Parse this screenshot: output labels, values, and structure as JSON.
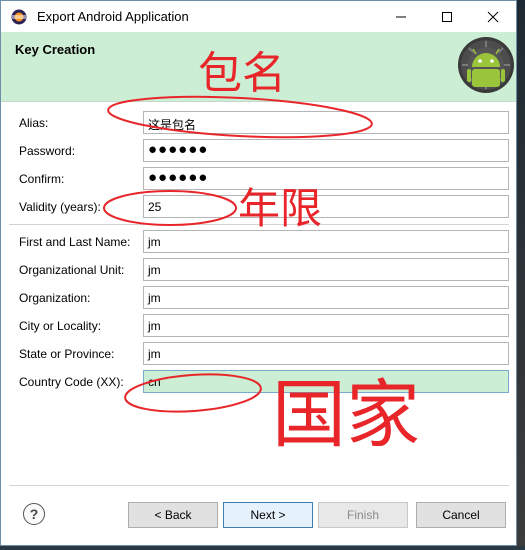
{
  "window": {
    "title": "Export Android Application"
  },
  "banner": {
    "title": "Key Creation"
  },
  "form": {
    "alias": {
      "label": "Alias:",
      "value": "这是包名"
    },
    "password": {
      "label": "Password:",
      "value": "●●●●●●"
    },
    "confirm": {
      "label": "Confirm:",
      "value": "●●●●●●"
    },
    "validity": {
      "label": "Validity (years):",
      "value": "25"
    },
    "first_last_name": {
      "label": "First and Last Name:",
      "value": "jm"
    },
    "org_unit": {
      "label": "Organizational Unit:",
      "value": "jm"
    },
    "organization": {
      "label": "Organization:",
      "value": "jm"
    },
    "city": {
      "label": "City or Locality:",
      "value": "jm"
    },
    "state": {
      "label": "State or Province:",
      "value": "jm"
    },
    "country": {
      "label": "Country Code (XX):",
      "value": "cn"
    }
  },
  "buttons": {
    "help": "?",
    "back": "< Back",
    "next": "Next >",
    "finish": "Finish",
    "cancel": "Cancel"
  },
  "annotations": {
    "package_name": "包名",
    "validity_years": "年限",
    "country": "国家"
  },
  "colors": {
    "banner_bg": "#cceed4",
    "annotation_red": "#e8262a",
    "android_green": "#9ac43a"
  }
}
